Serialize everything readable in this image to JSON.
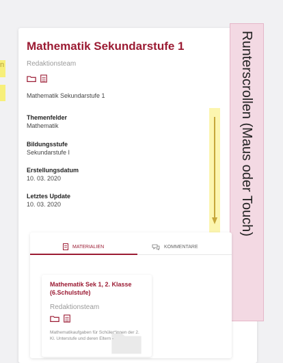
{
  "left_highlights": {
    "line_1": "n",
    "line_2": ""
  },
  "card": {
    "title": "Mathematik Sekundarstufe 1",
    "author": "Redaktionsteam",
    "description": "Mathematik Sekundarstufe 1",
    "meta": [
      {
        "label": "Themenfelder",
        "value": "Mathematik"
      },
      {
        "label": "Bildungsstufe",
        "value": "Sekundarstufe I"
      },
      {
        "label": "Erstellungsdatum",
        "value": "10. 03. 2020"
      },
      {
        "label": "Letztes Update",
        "value": "10. 03. 2020"
      }
    ]
  },
  "annotation": {
    "text": "Runterscrollen (Maus oder Touch)"
  },
  "tabs": {
    "materials": "MATERIALIEN",
    "comments": "KOMMENTARE"
  },
  "material_card": {
    "title": "Mathematik Sek 1, 2. Klasse (6.Schulstufe)",
    "author": "Redaktionsteam",
    "description": "Mathematikaufgaben für Schüler*innen der 2. Kl. Unterstufe und deren Eltern -"
  },
  "colors": {
    "accent": "#9b1b33",
    "highlight_yellow": "#fbf29b",
    "annotation_pink": "#f3d9e3"
  }
}
